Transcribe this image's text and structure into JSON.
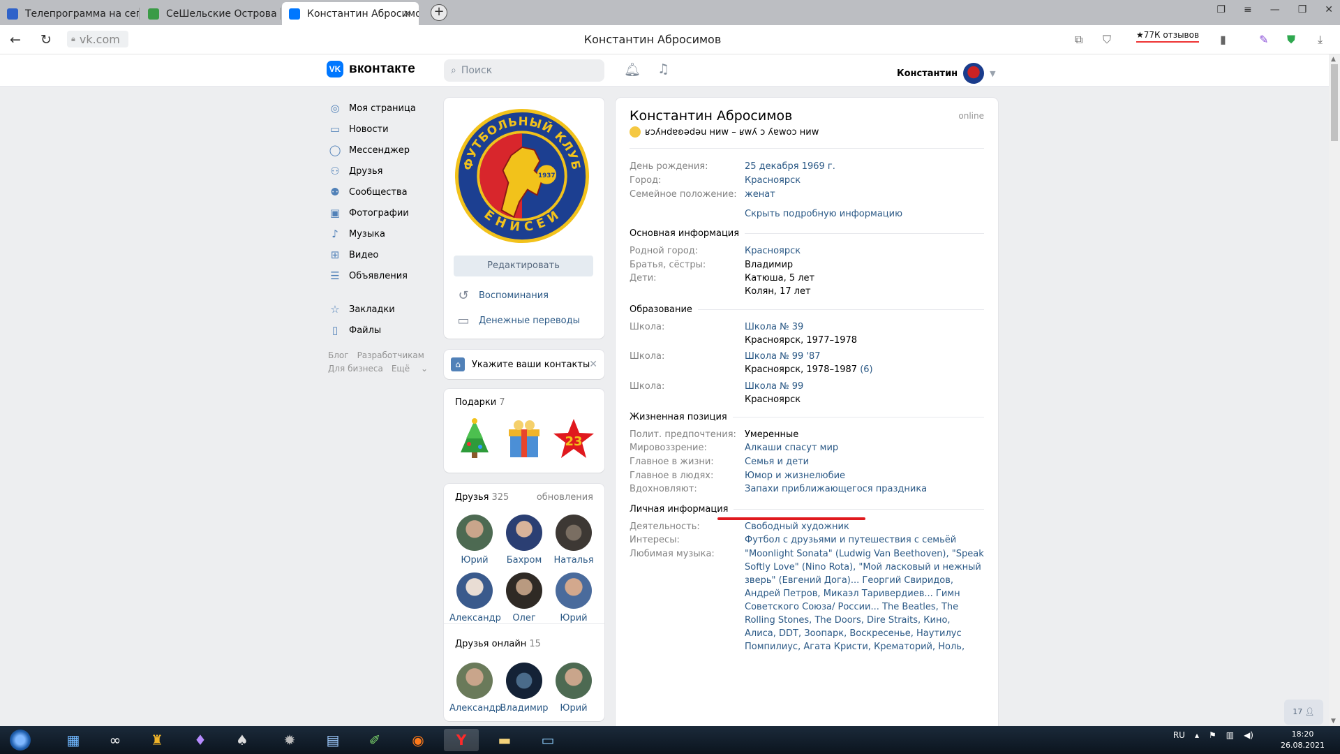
{
  "browser": {
    "tabs": [
      {
        "label": "Телепрограмма на сегодн",
        "active": false
      },
      {
        "label": "СеШельские Острова - Ст",
        "active": false
      },
      {
        "label": "Константин Абросимов",
        "active": true
      }
    ],
    "url": "vk.com",
    "page_title": "Константин Абросимов",
    "reviews_badge": "★77К отзывов"
  },
  "header": {
    "logo_text": "вконтакте",
    "logo_mark": "VK",
    "search_placeholder": "Поиск",
    "user_name": "Константин"
  },
  "left_menu": {
    "items": [
      {
        "label": "Моя страница",
        "icon": "user-circle-icon"
      },
      {
        "label": "Новости",
        "icon": "newspaper-icon"
      },
      {
        "label": "Мессенджер",
        "icon": "message-icon"
      },
      {
        "label": "Друзья",
        "icon": "friends-icon"
      },
      {
        "label": "Сообщества",
        "icon": "communities-icon"
      },
      {
        "label": "Фотографии",
        "icon": "photo-icon"
      },
      {
        "label": "Музыка",
        "icon": "music-icon"
      },
      {
        "label": "Видео",
        "icon": "video-icon"
      },
      {
        "label": "Объявления",
        "icon": "ads-icon"
      }
    ],
    "items2": [
      {
        "label": "Закладки",
        "icon": "star-icon"
      },
      {
        "label": "Файлы",
        "icon": "file-icon"
      }
    ],
    "footer": [
      "Блог",
      "Разработчикам",
      "Для бизнеса",
      "Ещё"
    ]
  },
  "photo_card": {
    "crest_top": "ФУТБОЛЬНЫЙ КЛУБ",
    "crest_bottom": "ЕНИСЕЙ",
    "crest_year": "1937",
    "edit_label": "Редактировать",
    "memories_label": "Воспоминания",
    "transfers_label": "Денежные переводы"
  },
  "contacts_prompt": "Укажите ваши контакты",
  "gifts": {
    "title": "Подарки",
    "count": "7"
  },
  "friends": {
    "title": "Друзья",
    "count": "325",
    "updates_label": "обновления",
    "list": [
      "Юрий",
      "Бахром",
      "Наталья",
      "Александр",
      "Олег",
      "Юрий"
    ]
  },
  "friends_online": {
    "title": "Друзья онлайн",
    "count": "15",
    "list": [
      "Александр",
      "Владимир",
      "Юрий"
    ]
  },
  "profile": {
    "name": "Константин Абросимов",
    "online": "online",
    "status": "ʁɔʎнdɐʚǝdǝu ниw – ʁwʎ ɔ ʎɐwоɔ ниw",
    "birthday_label": "День рождения:",
    "birthday": "25 декабря 1969 г.",
    "city_label": "Город:",
    "city": "Красноярск",
    "family_label": "Семейное положение:",
    "family": "женат",
    "hide_link": "Скрыть подробную информацию",
    "main_info": {
      "title": "Основная информация",
      "hometown_label": "Родной город:",
      "hometown": "Красноярск",
      "siblings_label": "Братья, сёстры:",
      "siblings": "Владимир",
      "kids_label": "Дети:",
      "kids": [
        "Катюша, 5 лет",
        "Колян, 17 лет"
      ]
    },
    "education": {
      "title": "Образование",
      "schools": [
        {
          "label": "Школа:",
          "name": "Школа № 39",
          "detail": "Красноярск, 1977–1978",
          "extra": ""
        },
        {
          "label": "Школа:",
          "name": "Школа № 99 '87",
          "detail": "Красноярск, 1978–1987",
          "extra": "(6)"
        },
        {
          "label": "Школа:",
          "name": "Школа № 99",
          "detail": "Красноярск",
          "extra": ""
        }
      ]
    },
    "life": {
      "title": "Жизненная позиция",
      "politics_label": "Полит. предпочтения:",
      "politics": "Умеренные",
      "worldview_label": "Мировоззрение:",
      "worldview": "Алкаши спасут мир",
      "main_life_label": "Главное в жизни:",
      "main_life": "Семья и дети",
      "main_people_label": "Главное в людях:",
      "main_people": "Юмор и жизнелюбие",
      "inspire_label": "Вдохновляют:",
      "inspire": "Запахи приближающегося праздника"
    },
    "personal": {
      "title": "Личная информация",
      "activity_label": "Деятельность:",
      "activity": "Свободный художник",
      "interests_label": "Интересы:",
      "interests": "Футбол с друзьями и путешествия с семьёй",
      "music_label": "Любимая музыка:",
      "music": "\"Moonlight Sonata\" (Ludwig Van Beethoven), \"Speak Softly Love\" (Nino Rota), \"Мой ласковый и нежный зверь\" (Евгений Дога)... Георгий Свиридов, Андрей Петров, Микаэл Таривердиев... Гимн Советского Союза/ России... The Beatles, The Rolling Stones, The Doors, Dire Straits, Кино, Алиса, DDT, Зоопарк, Воскресенье, Наутилус Помпилиус, Агата Кристи, Крематорий, Ноль,"
    }
  },
  "floating_counter": "17",
  "taskbar": {
    "lang": "RU",
    "time": "18:20",
    "date": "26.08.2021"
  },
  "colors": {
    "vk_blue": "#0077ff",
    "link": "#2a5885",
    "accent_red": "#e0191e"
  }
}
